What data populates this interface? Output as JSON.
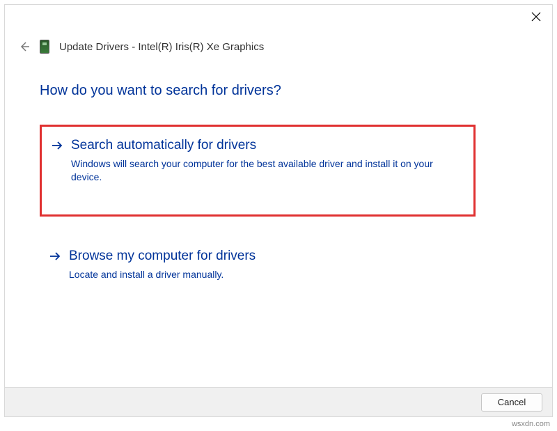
{
  "header": {
    "title": "Update Drivers - Intel(R) Iris(R) Xe Graphics"
  },
  "heading": "How do you want to search for drivers?",
  "options": [
    {
      "title": "Search automatically for drivers",
      "desc": "Windows will search your computer for the best available driver and install it on your device.",
      "highlighted": true
    },
    {
      "title": "Browse my computer for drivers",
      "desc": "Locate and install a driver manually.",
      "highlighted": false
    }
  ],
  "footer": {
    "cancel": "Cancel"
  },
  "watermark": "wsxdn.com"
}
